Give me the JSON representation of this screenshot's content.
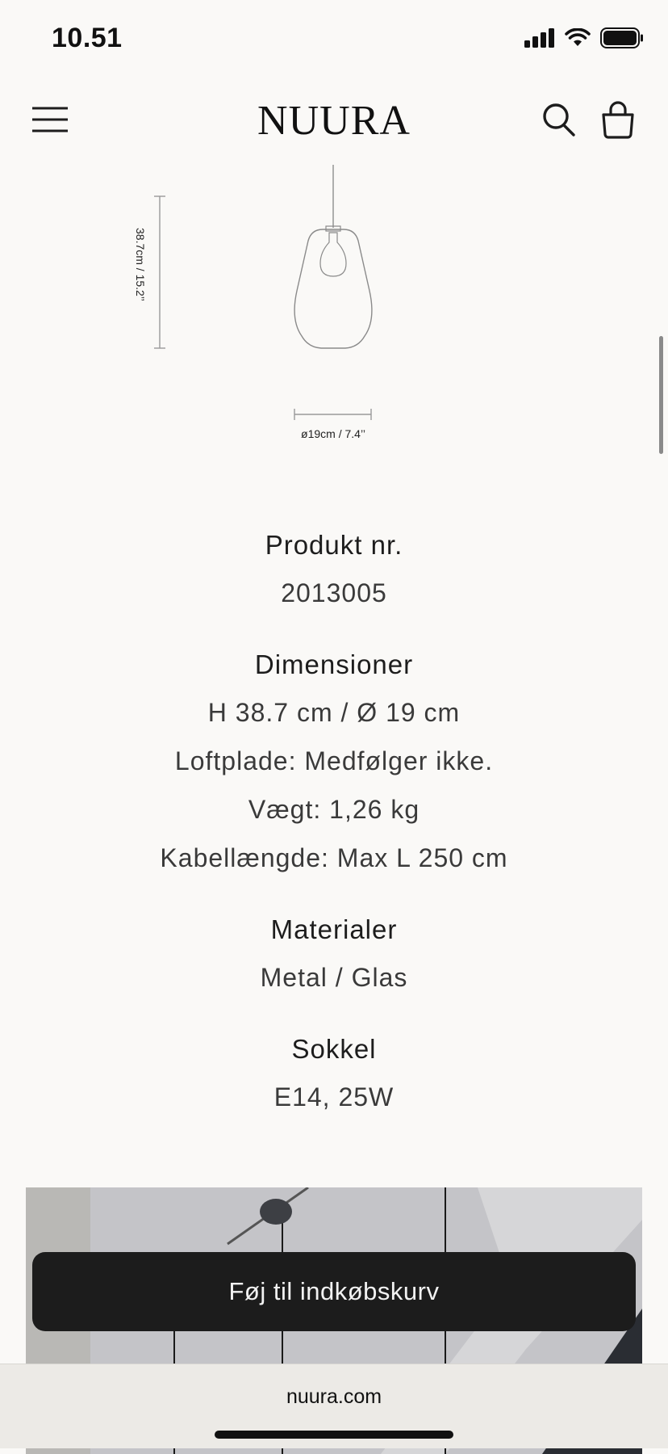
{
  "status": {
    "time": "10.51"
  },
  "header": {
    "logo": "NUURA"
  },
  "drawing": {
    "height_label": "38.7cm / 15.2’’",
    "diameter_label": "ø19cm / 7.4’’"
  },
  "specs": [
    {
      "title": "Produkt nr.",
      "values": [
        "2013005"
      ]
    },
    {
      "title": "Dimensioner",
      "values": [
        "H 38.7 cm / Ø 19 cm",
        "Loftplade: Medfølger ikke.",
        "Vægt: 1,26 kg",
        "Kabellængde: Max L 250 cm"
      ]
    },
    {
      "title": "Materialer",
      "values": [
        "Metal / Glas"
      ]
    },
    {
      "title": "Sokkel",
      "values": [
        "E14, 25W"
      ]
    }
  ],
  "cta": {
    "add_to_cart": "Føj til indkøbskurv"
  },
  "browser": {
    "url": "nuura.com"
  }
}
